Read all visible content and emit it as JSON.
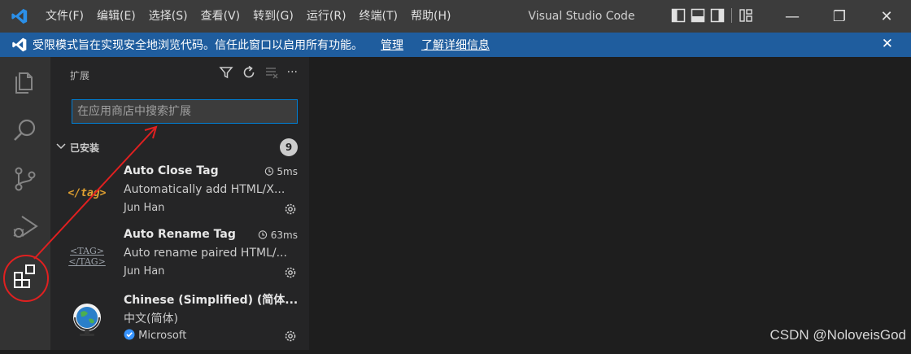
{
  "titlebar": {
    "menu": [
      "文件(F)",
      "编辑(E)",
      "选择(S)",
      "查看(V)",
      "转到(G)",
      "运行(R)",
      "终端(T)",
      "帮助(H)"
    ],
    "app_title": "Visual Studio Code",
    "minimize": "—",
    "restore": "❐",
    "close": "✕"
  },
  "banner": {
    "message": "受限模式旨在实现安全地浏览代码。信任此窗口以启用所有功能。",
    "manage": "管理",
    "learn_more": "了解详细信息",
    "close": "✕"
  },
  "sidebar": {
    "title": "扩展",
    "search_placeholder": "在应用商店中搜索扩展",
    "installed_label": "已安装",
    "installed_count": "9",
    "more": "···"
  },
  "extensions": [
    {
      "name": "Auto Close Tag",
      "time": "5ms",
      "desc": "Automatically add HTML/X...",
      "publisher": "Jun Han",
      "icon_label": "</tag>"
    },
    {
      "name": "Auto Rename Tag",
      "time": "63ms",
      "desc": "Auto rename paired HTML/...",
      "publisher": "Jun Han",
      "icon_label_top": "<TAG>",
      "icon_label_bottom": "</TAG>"
    },
    {
      "name": "Chinese (Simplified) (简体...",
      "time": "",
      "desc": "中文(简体)",
      "publisher": "Microsoft"
    }
  ],
  "watermark": "CSDN @NoloveisGod",
  "colors": {
    "accent": "#007fd4",
    "banner": "#1f5d9e",
    "annotation": "#e02020"
  }
}
